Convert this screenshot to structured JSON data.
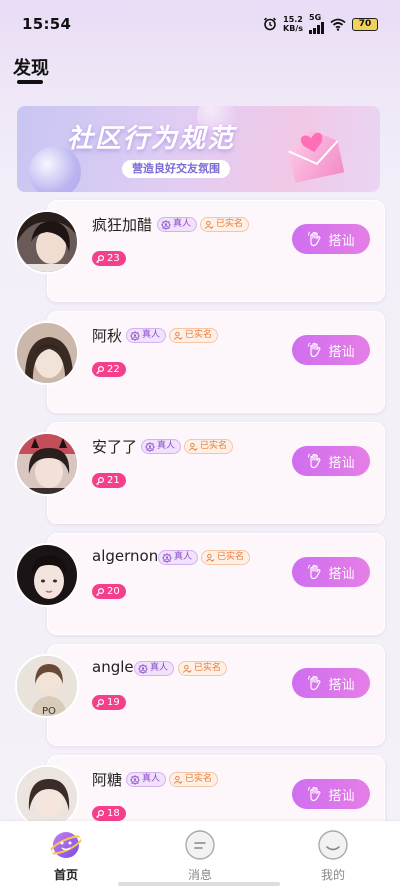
{
  "status_bar": {
    "time": "15:54",
    "net_speed_value": "15.2",
    "net_speed_unit": "KB/s",
    "network_type": "5G",
    "battery": "70"
  },
  "header": {
    "title": "发现"
  },
  "banner": {
    "title": "社区行为规范",
    "subtitle": "营造良好交友氛围"
  },
  "users": [
    {
      "name": "疯狂加醋",
      "real_badge": "真人",
      "verified_badge": "已实名",
      "count": "23",
      "button": "搭讪"
    },
    {
      "name": "阿秋",
      "real_badge": "真人",
      "verified_badge": "已实名",
      "count": "22",
      "button": "搭讪"
    },
    {
      "name": "安了了",
      "real_badge": "真人",
      "verified_badge": "已实名",
      "count": "21",
      "button": "搭讪"
    },
    {
      "name": "algernon",
      "real_badge": "真人",
      "verified_badge": "已实名",
      "count": "20",
      "button": "搭讪"
    },
    {
      "name": "angle",
      "real_badge": "真人",
      "verified_badge": "已实名",
      "count": "19",
      "button": "搭讪"
    },
    {
      "name": "阿糖",
      "real_badge": "真人",
      "verified_badge": "已实名",
      "count": "18",
      "button": "搭讪"
    }
  ],
  "bottom_nav": {
    "items": [
      {
        "label": "首页",
        "icon": "planet-icon",
        "active": true
      },
      {
        "label": "消息",
        "icon": "message-icon",
        "active": false
      },
      {
        "label": "我的",
        "icon": "profile-face-icon",
        "active": false
      }
    ]
  },
  "colors": {
    "accent_pink": "#f4408c",
    "button_gradient_start": "#cf6ef0",
    "button_gradient_end": "#e57ee6",
    "real_badge": "#8a4cc8",
    "verified_badge": "#e67a3a"
  }
}
